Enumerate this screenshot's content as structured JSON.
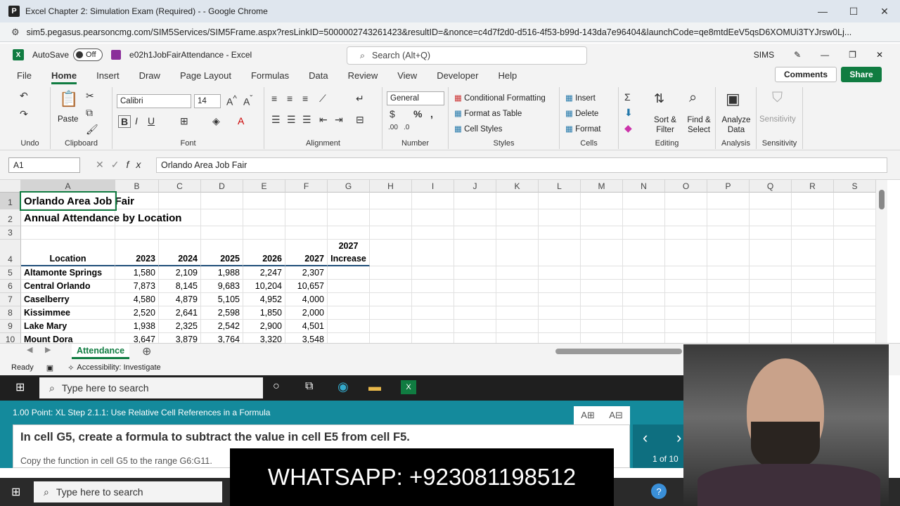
{
  "chrome": {
    "title": "Excel Chapter 2: Simulation Exam (Required) - - Google Chrome",
    "url": "sim5.pegasus.pearsoncmg.com/SIM5Services/SIM5Frame.aspx?resLinkID=5000002743261423&resultID=&nonce=c4d7f2d0-d516-4f53-b99d-143da7e96404&launchCode=qe8mtdEeV5qsD6XOMUi3TYJrsw0Lj...",
    "app_icon": "P"
  },
  "excel": {
    "autosave_label": "AutoSave",
    "autosave_state": "Off",
    "filename": "e02h1JobFairAttendance - Excel",
    "search_placeholder": "Search (Alt+Q)",
    "user": "SIMS"
  },
  "menu": {
    "items": [
      "File",
      "Home",
      "Insert",
      "Draw",
      "Page Layout",
      "Formulas",
      "Data",
      "Review",
      "View",
      "Developer",
      "Help"
    ],
    "comments": "Comments",
    "share": "Share"
  },
  "ribbon": {
    "groups": [
      "Undo",
      "Clipboard",
      "Font",
      "Alignment",
      "Number",
      "Styles",
      "Cells",
      "Editing",
      "Analysis",
      "Sensitivity"
    ],
    "paste": "Paste",
    "font_name": "Calibri",
    "font_size": "14",
    "number_format": "General",
    "styles": [
      "Conditional Formatting",
      "Format as Table",
      "Cell Styles"
    ],
    "cells": [
      "Insert",
      "Delete",
      "Format"
    ],
    "sort_filter": "Sort & Filter",
    "find_select": "Find & Select",
    "analyze": "Analyze Data",
    "sensitivity": "Sensitivity"
  },
  "formula_bar": {
    "name_box": "A1",
    "formula": "Orlando Area Job Fair"
  },
  "sheet": {
    "columns": [
      "A",
      "B",
      "C",
      "D",
      "E",
      "F",
      "G",
      "H",
      "I",
      "J",
      "K",
      "L",
      "M",
      "N",
      "O",
      "P",
      "Q",
      "R",
      "S"
    ],
    "rows": [
      "1",
      "2",
      "3",
      "4",
      "5",
      "6",
      "7",
      "8",
      "9",
      "10"
    ],
    "title": "Orlando Area Job Fair",
    "subtitle": "Annual Attendance by Location",
    "headers": [
      "Location",
      "2023",
      "2024",
      "2025",
      "2026",
      "2027"
    ],
    "g_header_1": "2027",
    "g_header_2": "Increase",
    "data": [
      [
        "Altamonte Springs",
        "1,580",
        "2,109",
        "1,988",
        "2,247",
        "2,307"
      ],
      [
        "Central Orlando",
        "7,873",
        "8,145",
        "9,683",
        "10,204",
        "10,657"
      ],
      [
        "Caselberry",
        "4,580",
        "4,879",
        "5,105",
        "4,952",
        "4,000"
      ],
      [
        "Kissimmee",
        "2,520",
        "2,641",
        "2,598",
        "1,850",
        "2,000"
      ],
      [
        "Lake Mary",
        "1,938",
        "2,325",
        "2,542",
        "2,900",
        "4,501"
      ],
      [
        "Mount Dora",
        "3,647",
        "3,879",
        "3,764",
        "3,320",
        "3,548"
      ]
    ],
    "tab": "Attendance"
  },
  "status": {
    "ready": "Ready",
    "accessibility": "Accessibility: Investigate"
  },
  "taskbar": {
    "search": "Type here to search"
  },
  "instructions": {
    "step": "1.00 Point: XL Step 2.1.1: Use Relative Cell References in a Formula",
    "main": "In cell G5, create a formula to subtract the value in cell E5 from cell F5.",
    "sub": "Copy the function in cell G5 to the range G6:G11.",
    "page": "1 of 10",
    "font_inc": "A",
    "font_dec": "A"
  },
  "overlay": {
    "whatsapp": "WHATSAPP: +923081198512"
  },
  "colors": {
    "excel_green": "#107c41",
    "instr_teal": "#148a9c"
  }
}
